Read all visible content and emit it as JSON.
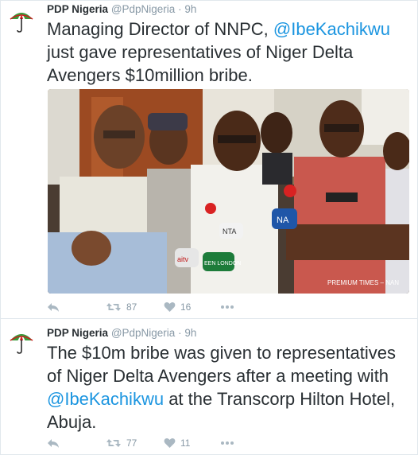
{
  "tweets": [
    {
      "name": "PDP Nigeria",
      "handle": "@PdpNigeria",
      "dot": "·",
      "time": "9h",
      "text_a": "Managing Director of NNPC, ",
      "mention": "@IbeKachikwu",
      "text_b": " just gave representatives of Niger Delta Avengers $10million bribe.",
      "photo_credit": "PREMIUM TIMES – NAN",
      "photo_mic_labels": [
        "NTA",
        "aitv",
        "EEN LONDON",
        "NA"
      ],
      "retweets": "87",
      "likes": "16"
    },
    {
      "name": "PDP Nigeria",
      "handle": "@PdpNigeria",
      "dot": "·",
      "time": "9h",
      "text_a": "The $10m bribe was given to representatives of Niger Delta Avengers after a meeting with ",
      "mention": "@IbeKachikwu",
      "text_b": " at the Transcorp Hilton Hotel, Abuja.",
      "retweets": "77",
      "likes": "11"
    }
  ],
  "icons": {
    "avatar": "pdp-umbrella-logo",
    "reply": "reply-icon",
    "retweet": "retweet-icon",
    "like": "heart-icon",
    "more": "more-icon"
  },
  "colors": {
    "link": "#1b95e0",
    "action": "#aab8c2",
    "meta": "#8899a6",
    "text": "#292f33"
  }
}
